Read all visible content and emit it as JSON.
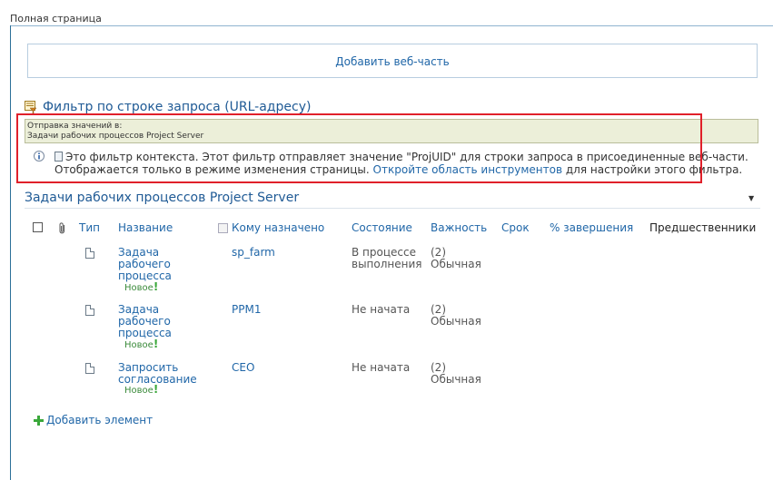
{
  "zone": {
    "title": "Полная страница"
  },
  "add_webpart": {
    "label": "Добавить веб-часть"
  },
  "filter": {
    "title": "Фильтр по строке запроса (URL-адресу)",
    "sending_label": "Отправка значений в:",
    "sending_target": "Задачи рабочих процессов Project Server",
    "info_line1": "Это фильтр контекста. Этот фильтр отправляет значение \"ProjUID\" для строки запроса в присоединенные веб-части.",
    "info_line2_prefix": "Отображается только в режиме изменения страницы. ",
    "info_link": "Откройте область инструментов",
    "info_line2_suffix": " для настройки этого фильтра."
  },
  "list": {
    "title": "Задачи рабочих процессов Project Server",
    "menu_icon": "dropdown-arrow-icon",
    "columns": {
      "type": "Тип",
      "name": "Название",
      "assigned": "Кому назначено",
      "status": "Состояние",
      "priority": "Важность",
      "due": "Срок",
      "percent": "% завершения",
      "predecessors": "Предшественники"
    },
    "rows": [
      {
        "name_lines": [
          "Задача",
          "рабочего",
          "процесса"
        ],
        "new_label": "Новое",
        "assigned": "sp_farm",
        "status_lines": [
          "В процессе",
          "выполнения"
        ],
        "priority_lines": [
          "(2)",
          "Обычная"
        ]
      },
      {
        "name_lines": [
          "Задача",
          "рабочего",
          "процесса"
        ],
        "new_label": "Новое",
        "assigned": "PPM1",
        "status_lines": [
          "Не начата",
          ""
        ],
        "priority_lines": [
          "(2)",
          "Обычная"
        ]
      },
      {
        "name_lines": [
          "Запросить",
          "согласование",
          ""
        ],
        "new_label": "Новое",
        "assigned": "CEO",
        "status_lines": [
          "Не начата",
          ""
        ],
        "priority_lines": [
          "(2)",
          "Обычная"
        ]
      }
    ],
    "add_item": "Добавить элемент"
  },
  "colors": {
    "link": "#2167a8",
    "highlight": "#e0202a",
    "new": "#3aa83a"
  }
}
